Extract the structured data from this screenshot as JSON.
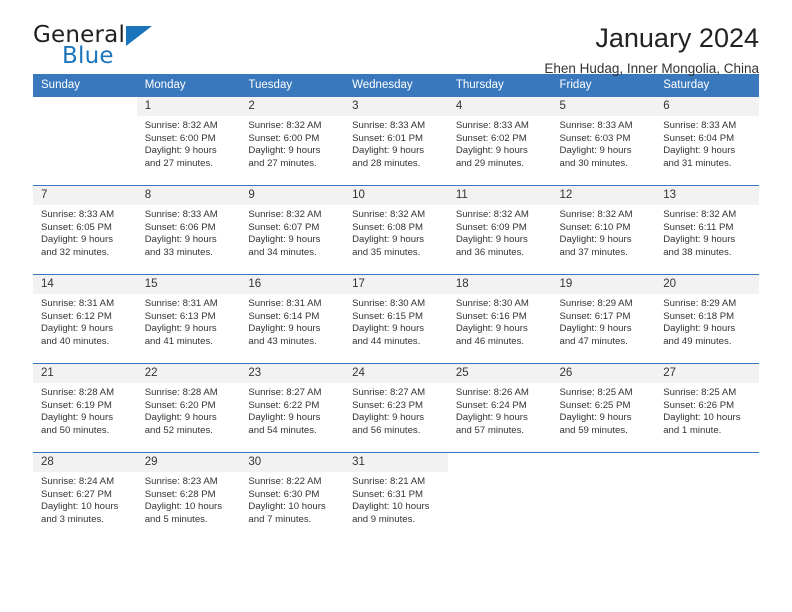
{
  "brand": {
    "name_top": "General",
    "name_bottom": "Blue",
    "accent_color": "#1b75bc"
  },
  "header": {
    "title": "January 2024",
    "subtitle": "Ehen Hudag, Inner Mongolia, China"
  },
  "calendar": {
    "header_color": "#3978bc",
    "daynum_band_color": "#f2f2f2",
    "weekday_headers": [
      "Sunday",
      "Monday",
      "Tuesday",
      "Wednesday",
      "Thursday",
      "Friday",
      "Saturday"
    ],
    "labels": {
      "sunrise": "Sunrise:",
      "sunset": "Sunset:",
      "daylight": "Daylight:"
    },
    "weeks": [
      [
        {
          "day": "",
          "sunrise": "",
          "sunset": "",
          "daylight_line1": "",
          "daylight_line2": "",
          "blank": true
        },
        {
          "day": "1",
          "sunrise": "Sunrise: 8:32 AM",
          "sunset": "Sunset: 6:00 PM",
          "daylight_line1": "Daylight: 9 hours",
          "daylight_line2": "and 27 minutes."
        },
        {
          "day": "2",
          "sunrise": "Sunrise: 8:32 AM",
          "sunset": "Sunset: 6:00 PM",
          "daylight_line1": "Daylight: 9 hours",
          "daylight_line2": "and 27 minutes."
        },
        {
          "day": "3",
          "sunrise": "Sunrise: 8:33 AM",
          "sunset": "Sunset: 6:01 PM",
          "daylight_line1": "Daylight: 9 hours",
          "daylight_line2": "and 28 minutes."
        },
        {
          "day": "4",
          "sunrise": "Sunrise: 8:33 AM",
          "sunset": "Sunset: 6:02 PM",
          "daylight_line1": "Daylight: 9 hours",
          "daylight_line2": "and 29 minutes."
        },
        {
          "day": "5",
          "sunrise": "Sunrise: 8:33 AM",
          "sunset": "Sunset: 6:03 PM",
          "daylight_line1": "Daylight: 9 hours",
          "daylight_line2": "and 30 minutes."
        },
        {
          "day": "6",
          "sunrise": "Sunrise: 8:33 AM",
          "sunset": "Sunset: 6:04 PM",
          "daylight_line1": "Daylight: 9 hours",
          "daylight_line2": "and 31 minutes."
        }
      ],
      [
        {
          "day": "7",
          "sunrise": "Sunrise: 8:33 AM",
          "sunset": "Sunset: 6:05 PM",
          "daylight_line1": "Daylight: 9 hours",
          "daylight_line2": "and 32 minutes."
        },
        {
          "day": "8",
          "sunrise": "Sunrise: 8:33 AM",
          "sunset": "Sunset: 6:06 PM",
          "daylight_line1": "Daylight: 9 hours",
          "daylight_line2": "and 33 minutes."
        },
        {
          "day": "9",
          "sunrise": "Sunrise: 8:32 AM",
          "sunset": "Sunset: 6:07 PM",
          "daylight_line1": "Daylight: 9 hours",
          "daylight_line2": "and 34 minutes."
        },
        {
          "day": "10",
          "sunrise": "Sunrise: 8:32 AM",
          "sunset": "Sunset: 6:08 PM",
          "daylight_line1": "Daylight: 9 hours",
          "daylight_line2": "and 35 minutes."
        },
        {
          "day": "11",
          "sunrise": "Sunrise: 8:32 AM",
          "sunset": "Sunset: 6:09 PM",
          "daylight_line1": "Daylight: 9 hours",
          "daylight_line2": "and 36 minutes."
        },
        {
          "day": "12",
          "sunrise": "Sunrise: 8:32 AM",
          "sunset": "Sunset: 6:10 PM",
          "daylight_line1": "Daylight: 9 hours",
          "daylight_line2": "and 37 minutes."
        },
        {
          "day": "13",
          "sunrise": "Sunrise: 8:32 AM",
          "sunset": "Sunset: 6:11 PM",
          "daylight_line1": "Daylight: 9 hours",
          "daylight_line2": "and 38 minutes."
        }
      ],
      [
        {
          "day": "14",
          "sunrise": "Sunrise: 8:31 AM",
          "sunset": "Sunset: 6:12 PM",
          "daylight_line1": "Daylight: 9 hours",
          "daylight_line2": "and 40 minutes."
        },
        {
          "day": "15",
          "sunrise": "Sunrise: 8:31 AM",
          "sunset": "Sunset: 6:13 PM",
          "daylight_line1": "Daylight: 9 hours",
          "daylight_line2": "and 41 minutes."
        },
        {
          "day": "16",
          "sunrise": "Sunrise: 8:31 AM",
          "sunset": "Sunset: 6:14 PM",
          "daylight_line1": "Daylight: 9 hours",
          "daylight_line2": "and 43 minutes."
        },
        {
          "day": "17",
          "sunrise": "Sunrise: 8:30 AM",
          "sunset": "Sunset: 6:15 PM",
          "daylight_line1": "Daylight: 9 hours",
          "daylight_line2": "and 44 minutes."
        },
        {
          "day": "18",
          "sunrise": "Sunrise: 8:30 AM",
          "sunset": "Sunset: 6:16 PM",
          "daylight_line1": "Daylight: 9 hours",
          "daylight_line2": "and 46 minutes."
        },
        {
          "day": "19",
          "sunrise": "Sunrise: 8:29 AM",
          "sunset": "Sunset: 6:17 PM",
          "daylight_line1": "Daylight: 9 hours",
          "daylight_line2": "and 47 minutes."
        },
        {
          "day": "20",
          "sunrise": "Sunrise: 8:29 AM",
          "sunset": "Sunset: 6:18 PM",
          "daylight_line1": "Daylight: 9 hours",
          "daylight_line2": "and 49 minutes."
        }
      ],
      [
        {
          "day": "21",
          "sunrise": "Sunrise: 8:28 AM",
          "sunset": "Sunset: 6:19 PM",
          "daylight_line1": "Daylight: 9 hours",
          "daylight_line2": "and 50 minutes."
        },
        {
          "day": "22",
          "sunrise": "Sunrise: 8:28 AM",
          "sunset": "Sunset: 6:20 PM",
          "daylight_line1": "Daylight: 9 hours",
          "daylight_line2": "and 52 minutes."
        },
        {
          "day": "23",
          "sunrise": "Sunrise: 8:27 AM",
          "sunset": "Sunset: 6:22 PM",
          "daylight_line1": "Daylight: 9 hours",
          "daylight_line2": "and 54 minutes."
        },
        {
          "day": "24",
          "sunrise": "Sunrise: 8:27 AM",
          "sunset": "Sunset: 6:23 PM",
          "daylight_line1": "Daylight: 9 hours",
          "daylight_line2": "and 56 minutes."
        },
        {
          "day": "25",
          "sunrise": "Sunrise: 8:26 AM",
          "sunset": "Sunset: 6:24 PM",
          "daylight_line1": "Daylight: 9 hours",
          "daylight_line2": "and 57 minutes."
        },
        {
          "day": "26",
          "sunrise": "Sunrise: 8:25 AM",
          "sunset": "Sunset: 6:25 PM",
          "daylight_line1": "Daylight: 9 hours",
          "daylight_line2": "and 59 minutes."
        },
        {
          "day": "27",
          "sunrise": "Sunrise: 8:25 AM",
          "sunset": "Sunset: 6:26 PM",
          "daylight_line1": "Daylight: 10 hours",
          "daylight_line2": "and 1 minute."
        }
      ],
      [
        {
          "day": "28",
          "sunrise": "Sunrise: 8:24 AM",
          "sunset": "Sunset: 6:27 PM",
          "daylight_line1": "Daylight: 10 hours",
          "daylight_line2": "and 3 minutes."
        },
        {
          "day": "29",
          "sunrise": "Sunrise: 8:23 AM",
          "sunset": "Sunset: 6:28 PM",
          "daylight_line1": "Daylight: 10 hours",
          "daylight_line2": "and 5 minutes."
        },
        {
          "day": "30",
          "sunrise": "Sunrise: 8:22 AM",
          "sunset": "Sunset: 6:30 PM",
          "daylight_line1": "Daylight: 10 hours",
          "daylight_line2": "and 7 minutes."
        },
        {
          "day": "31",
          "sunrise": "Sunrise: 8:21 AM",
          "sunset": "Sunset: 6:31 PM",
          "daylight_line1": "Daylight: 10 hours",
          "daylight_line2": "and 9 minutes."
        },
        {
          "day": "",
          "sunrise": "",
          "sunset": "",
          "daylight_line1": "",
          "daylight_line2": "",
          "blank": true
        },
        {
          "day": "",
          "sunrise": "",
          "sunset": "",
          "daylight_line1": "",
          "daylight_line2": "",
          "blank": true
        },
        {
          "day": "",
          "sunrise": "",
          "sunset": "",
          "daylight_line1": "",
          "daylight_line2": "",
          "blank": true
        }
      ]
    ]
  }
}
